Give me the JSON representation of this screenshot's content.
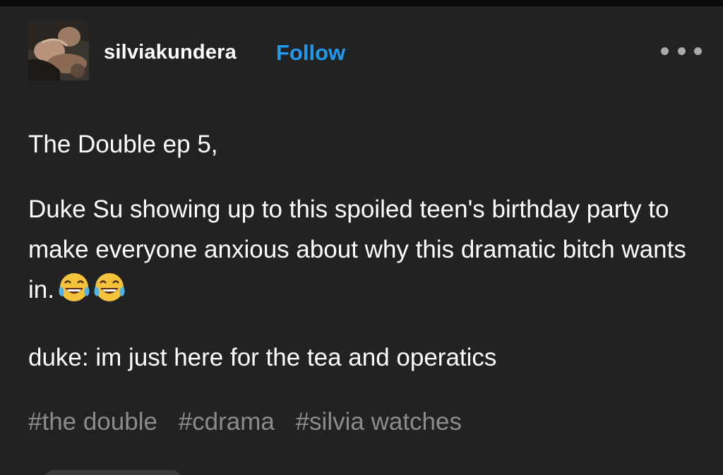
{
  "post": {
    "username": "silviakundera",
    "follow_label": "Follow",
    "more_icon": "ellipsis-icon",
    "body": {
      "line1": "The Double ep 5,",
      "paragraph2": "Duke Su showing up to this spoiled teen's birthday party to make everyone anxious about why this dramatic bitch wants in.",
      "emoji": "😂😂",
      "paragraph3": "duke: im just here for the tea and operatics"
    },
    "tags": [
      "#the double",
      "#cdrama",
      "#silvia watches"
    ]
  },
  "colors": {
    "background": "#222222",
    "follow_blue": "#1e9bf0",
    "tag_gray": "#8c8c8c",
    "text": "#ffffff"
  }
}
